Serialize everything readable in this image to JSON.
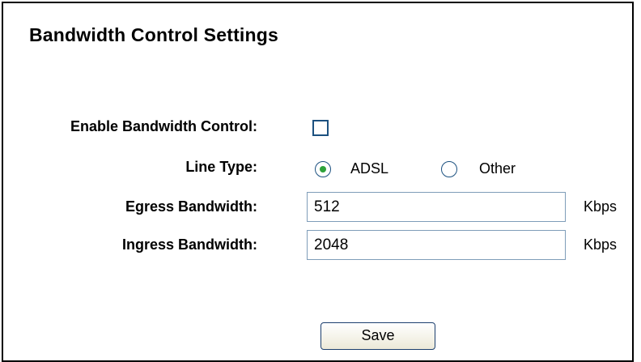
{
  "page": {
    "title": "Bandwidth Control Settings"
  },
  "form": {
    "enable_label": "Enable Bandwidth Control:",
    "enable_checked": false,
    "line_type_label": "Line Type:",
    "line_type_options": [
      "ADSL",
      "Other"
    ],
    "line_type_selected": "ADSL",
    "egress_label": "Egress Bandwidth:",
    "egress_value": "512",
    "egress_unit": "Kbps",
    "ingress_label": "Ingress Bandwidth:",
    "ingress_value": "2048",
    "ingress_unit": "Kbps"
  },
  "actions": {
    "save_label": "Save"
  }
}
